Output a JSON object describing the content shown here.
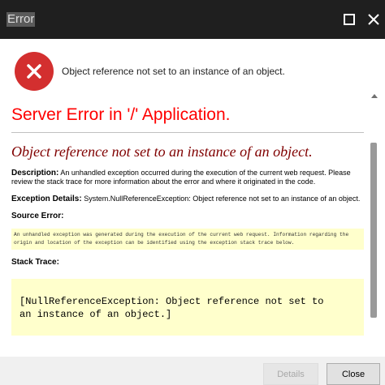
{
  "window": {
    "title": "Error",
    "maximize_icon": "maximize-icon",
    "close_icon": "close-icon"
  },
  "header": {
    "icon": "error-x-icon",
    "icon_color": "#d32f2f",
    "message": "Object reference not set to an instance of an object."
  },
  "page": {
    "server_error_title": "Server Error in '/' Application.",
    "exception_heading": "Object reference not set to an instance of an object.",
    "description_label": "Description:",
    "description_text": "An unhandled exception occurred during the execution of the current web request. Please review the stack trace for more information about the error and where it originated in the code.",
    "exception_details_label": "Exception Details:",
    "exception_details_text": "System.NullReferenceException: Object reference not set to an instance of an object.",
    "source_error_label": "Source Error:",
    "source_error_text": "An unhandled exception was generated during the execution of the current web request. Information regarding the origin and location of the exception can be identified using the exception stack trace below.",
    "stack_trace_label": "Stack Trace:",
    "stack_trace_line1": "[NullReferenceException: Object reference not set to",
    "stack_trace_line2": "an instance of an object.]"
  },
  "colors": {
    "title_red": "#ff0000",
    "heading_maroon": "#800000",
    "code_background": "#ffffcc"
  },
  "footer": {
    "details_label": "Details",
    "close_label": "Close"
  }
}
